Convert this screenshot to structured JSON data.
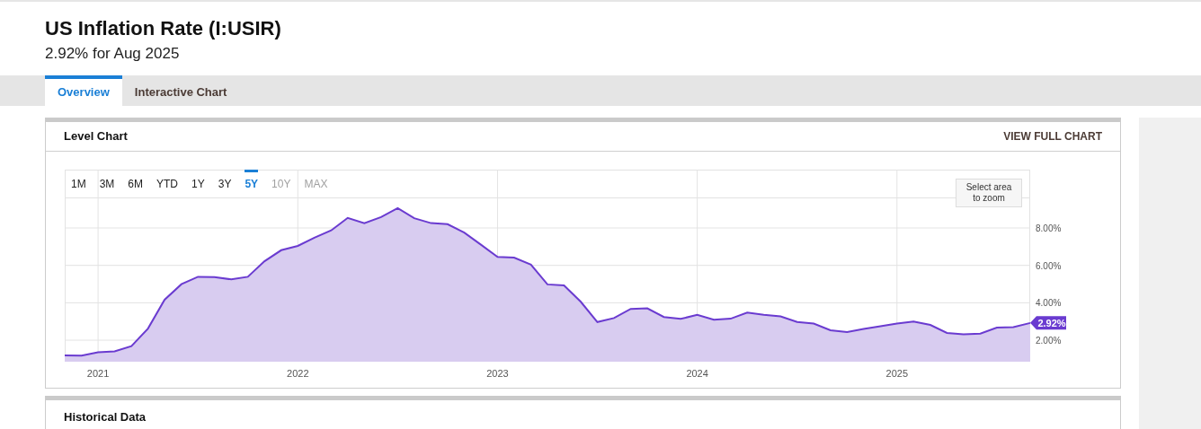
{
  "header": {
    "title": "US Inflation Rate (I:USIR)",
    "subtitle": "2.92% for Aug 2025"
  },
  "tabs": [
    {
      "label": "Overview",
      "selected": true
    },
    {
      "label": "Interactive Chart",
      "selected": false
    }
  ],
  "level_chart": {
    "title": "Level Chart",
    "action": "VIEW FULL CHART",
    "ranges": [
      {
        "label": "1M",
        "selected": false,
        "disabled": false
      },
      {
        "label": "3M",
        "selected": false,
        "disabled": false
      },
      {
        "label": "6M",
        "selected": false,
        "disabled": false
      },
      {
        "label": "YTD",
        "selected": false,
        "disabled": false
      },
      {
        "label": "1Y",
        "selected": false,
        "disabled": false
      },
      {
        "label": "3Y",
        "selected": false,
        "disabled": false
      },
      {
        "label": "5Y",
        "selected": true,
        "disabled": false
      },
      {
        "label": "10Y",
        "selected": false,
        "disabled": true
      },
      {
        "label": "MAX",
        "selected": false,
        "disabled": true
      }
    ],
    "zoom_hint": "Select area to zoom",
    "chart_data": {
      "type": "area",
      "x": [
        2020.833,
        2020.917,
        2021.0,
        2021.083,
        2021.167,
        2021.25,
        2021.333,
        2021.417,
        2021.5,
        2021.583,
        2021.667,
        2021.75,
        2021.833,
        2021.917,
        2022.0,
        2022.083,
        2022.167,
        2022.25,
        2022.333,
        2022.417,
        2022.5,
        2022.583,
        2022.667,
        2022.75,
        2022.833,
        2022.917,
        2023.0,
        2023.083,
        2023.167,
        2023.25,
        2023.333,
        2023.417,
        2023.5,
        2023.583,
        2023.667,
        2023.75,
        2023.833,
        2023.917,
        2024.0,
        2024.083,
        2024.167,
        2024.25,
        2024.333,
        2024.417,
        2024.5,
        2024.583,
        2024.667,
        2024.75,
        2024.833,
        2024.917,
        2025.0,
        2025.083,
        2025.167,
        2025.25,
        2025.333,
        2025.417,
        2025.5,
        2025.583,
        2025.667
      ],
      "series": [
        {
          "color": "#6a3bd0",
          "values": [
            1.18,
            1.17,
            1.36,
            1.4,
            1.68,
            2.62,
            4.16,
            4.99,
            5.39,
            5.37,
            5.25,
            5.39,
            6.22,
            6.81,
            7.04,
            7.48,
            7.87,
            8.54,
            8.26,
            8.58,
            9.06,
            8.52,
            8.26,
            8.2,
            7.75,
            7.11,
            6.45,
            6.41,
            6.04,
            4.98,
            4.93,
            4.05,
            2.97,
            3.18,
            3.67,
            3.7,
            3.24,
            3.14,
            3.35,
            3.09,
            3.15,
            3.48,
            3.36,
            3.27,
            2.97,
            2.89,
            2.53,
            2.44,
            2.6,
            2.75,
            2.89,
            3.0,
            2.82,
            2.39,
            2.31,
            2.35,
            2.67,
            2.7,
            2.92
          ]
        }
      ],
      "xlim": [
        2020.833,
        2025.667
      ],
      "ylim": [
        0.85,
        11.12
      ],
      "grid": true,
      "xticks": [
        2021,
        2022,
        2023,
        2024,
        2025
      ],
      "yticks": [
        {
          "value": 2,
          "label": "2.00%"
        },
        {
          "value": 4,
          "label": "4.00%"
        },
        {
          "value": 6,
          "label": "6.00%"
        },
        {
          "value": 8,
          "label": "8.00%"
        }
      ],
      "annotations": [
        {
          "text": "2.92%",
          "x": 2025.667,
          "y": 2.92
        }
      ]
    }
  },
  "historical_data": {
    "title": "Historical Data"
  }
}
